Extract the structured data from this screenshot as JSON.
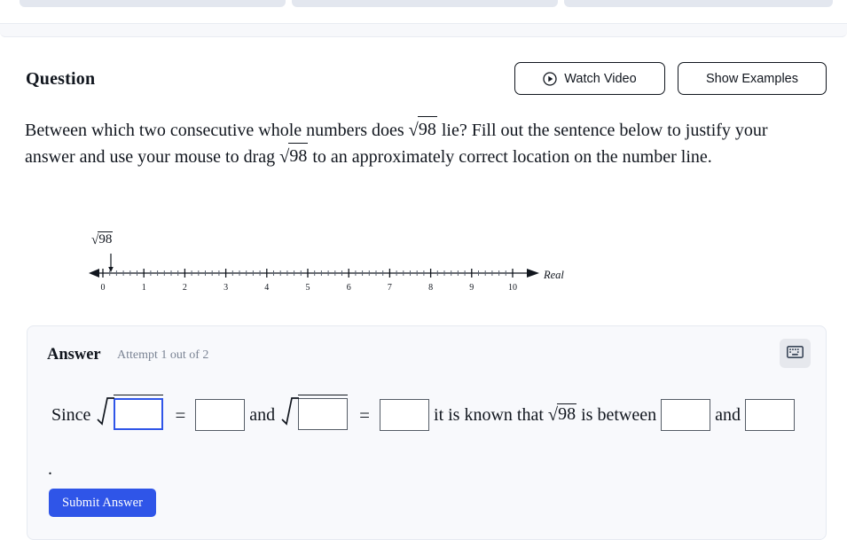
{
  "top_tabs": [
    {
      "label": ""
    },
    {
      "label": ""
    },
    {
      "label": ""
    }
  ],
  "question": {
    "heading": "Question",
    "watch_video_label": "Watch Video",
    "show_examples_label": "Show Examples",
    "text_part1": "Between which two consecutive whole numbers does",
    "radicand1": "98",
    "text_part2": "lie? Fill out the sentence below to justify your answer and use your mouse to drag",
    "radicand2": "98",
    "text_part3": "to an approximately correct location on the number line."
  },
  "number_line": {
    "drag_label_radicand": "98",
    "axis_label": "Real",
    "min": 0,
    "max": 10,
    "ticks": [
      "0",
      "1",
      "2",
      "3",
      "4",
      "5",
      "6",
      "7",
      "8",
      "9",
      "10"
    ],
    "minor_ticks_per_interval": 5,
    "marker_position": 0
  },
  "answer": {
    "heading": "Answer",
    "attempt_text": "Attempt 1 out of 2",
    "keyboard_icon": "keyboard-icon",
    "sentence": {
      "since": "Since",
      "radical1_value": "",
      "equals1": "=",
      "result1_value": "",
      "and1": "and",
      "radical2_value": "",
      "equals2": "=",
      "result2_value": "",
      "known_text": "it is known that",
      "known_radicand": "98",
      "between_text": "is between",
      "lower_value": "",
      "and2": "and",
      "upper_value": "",
      "period": "."
    },
    "submit_label": "Submit Answer"
  },
  "colors": {
    "accent_blue": "#2f55e8",
    "panel_bg": "#f8f9fc",
    "panel_border": "#e6eaf1",
    "tab_chip": "#e3e7ef",
    "muted_text": "#7b8494",
    "text": "#11161e"
  }
}
